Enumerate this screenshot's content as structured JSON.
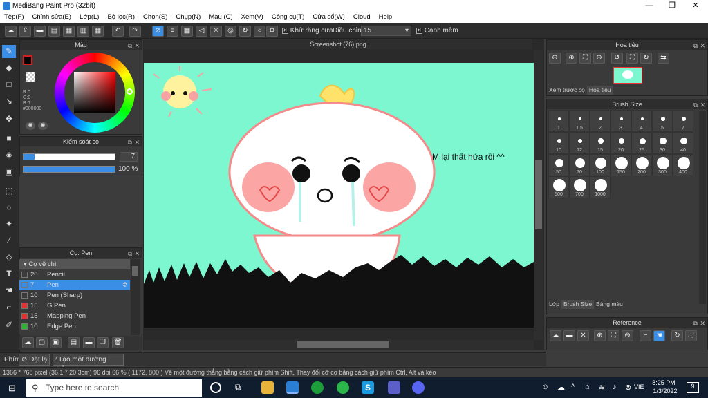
{
  "window": {
    "title": "MediBang Paint Pro (32bit)",
    "min": "—",
    "max": "❐",
    "close": "✕"
  },
  "menu": [
    "Tệp(F)",
    "Chỉnh sửa(E)",
    "Lớp(L)",
    "Bộ lọc(R)",
    "Chọn(S)",
    "Chụp(N)",
    "Màu (C)",
    "Xem(V)",
    "Công cụ(T)",
    "Cửa sổ(W)",
    "Cloud",
    "Help"
  ],
  "toolbar": {
    "antialias_label": "Khử răng cưa",
    "adjust_label": "Điều chỉnh",
    "adjust_value": "15",
    "smooth_label": "Cạnh mềm"
  },
  "color_panel": {
    "title": "Màu",
    "r": "R:0",
    "g": "G:0",
    "b": "B:0",
    "hex": "#000000"
  },
  "brush_control": {
    "title": "Kiểm soát cọ",
    "size": "7",
    "opacity": "100 %"
  },
  "brush_panel": {
    "title": "Cọ: Pen",
    "category": "Cọ vẽ chì",
    "items": [
      {
        "size": "20",
        "name": "Pencil",
        "color": "#222222"
      },
      {
        "size": "7",
        "name": "Pen",
        "color": "#222222"
      },
      {
        "size": "10",
        "name": "Pen (Sharp)",
        "color": "#222222"
      },
      {
        "size": "15",
        "name": "G Pen",
        "color": "#e53030"
      },
      {
        "size": "15",
        "name": "Mapping Pen",
        "color": "#e53030"
      },
      {
        "size": "10",
        "name": "Edge Pen",
        "color": "#2bb52b"
      }
    ]
  },
  "document": {
    "tab": "Screenshot (76).png",
    "canvas_text": "M lại thất hứa rồi ^^"
  },
  "navigator": {
    "title": "Hoa tiêu",
    "tabs": [
      "Xem trước cọ",
      "Hoa tiêu"
    ]
  },
  "brush_size": {
    "title": "Brush Size",
    "sizes": [
      "1",
      "1.5",
      "2",
      "3",
      "4",
      "5",
      "7",
      "10",
      "12",
      "15",
      "20",
      "25",
      "30",
      "40",
      "50",
      "70",
      "100",
      "150",
      "200",
      "300",
      "400",
      "500",
      "700",
      "1000"
    ],
    "tabs": [
      "Lớp",
      "Brush Size",
      "Bảng màu"
    ]
  },
  "reference": {
    "title": "Reference"
  },
  "bottom": {
    "tab_label": "Phím",
    "reset_label": "Đặt lại",
    "line_label": "Tạo một đường thẳng"
  },
  "status": {
    "text": "1366 * 768 pixel   (36.1 * 20.3cm)   96 dpi   66 %   ( 1172, 800 )   Vẽ một đường thẳng bằng cách giữ phím Shift, Thay đổi cỡ cọ bằng cách giữ phím Ctrl, Alt và kéo"
  },
  "taskbar": {
    "search": "Type here to search",
    "time": "8:25 PM",
    "date": "1/3/2022",
    "lang": "VIE",
    "notif": "9"
  }
}
